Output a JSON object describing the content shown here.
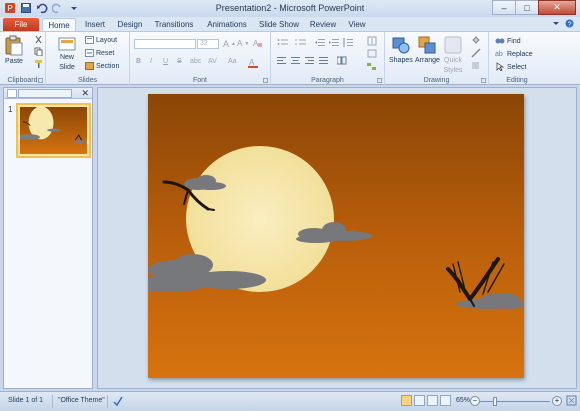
{
  "window": {
    "title": "Presentation2 - Microsoft PowerPoint",
    "controls": {
      "minimize": "–",
      "maximize": "□",
      "close": "✕"
    }
  },
  "tabs": [
    "File",
    "Home",
    "Insert",
    "Design",
    "Transitions",
    "Animations",
    "Slide Show",
    "Review",
    "View"
  ],
  "ribbon": {
    "clipboard": {
      "label": "Clipboard",
      "paste": "Paste"
    },
    "slides": {
      "label": "Slides",
      "new_slide_line1": "New",
      "new_slide_line2": "Slide",
      "layout": "Layout",
      "reset": "Reset",
      "section": "Section"
    },
    "font": {
      "label": "Font",
      "size": "32"
    },
    "paragraph": {
      "label": "Paragraph"
    },
    "drawing": {
      "label": "Drawing",
      "shapes": "Shapes",
      "arrange": "Arrange",
      "quick_styles_line1": "Quick",
      "quick_styles_line2": "Styles"
    },
    "editing": {
      "label": "Editing",
      "find": "Find",
      "replace": "Replace",
      "select": "Select"
    }
  },
  "thumbnails": [
    {
      "number": "1"
    }
  ],
  "status": {
    "slide_info": "Slide 1 of 1",
    "theme": "\"Office Theme\"",
    "zoom": "65%"
  },
  "colors": {
    "sky_top": "#8a4606",
    "sky_bottom": "#d6730f",
    "moon": "#f7e9ae",
    "cloud": "#7d7d80",
    "file_tab": "#d84a2b"
  }
}
